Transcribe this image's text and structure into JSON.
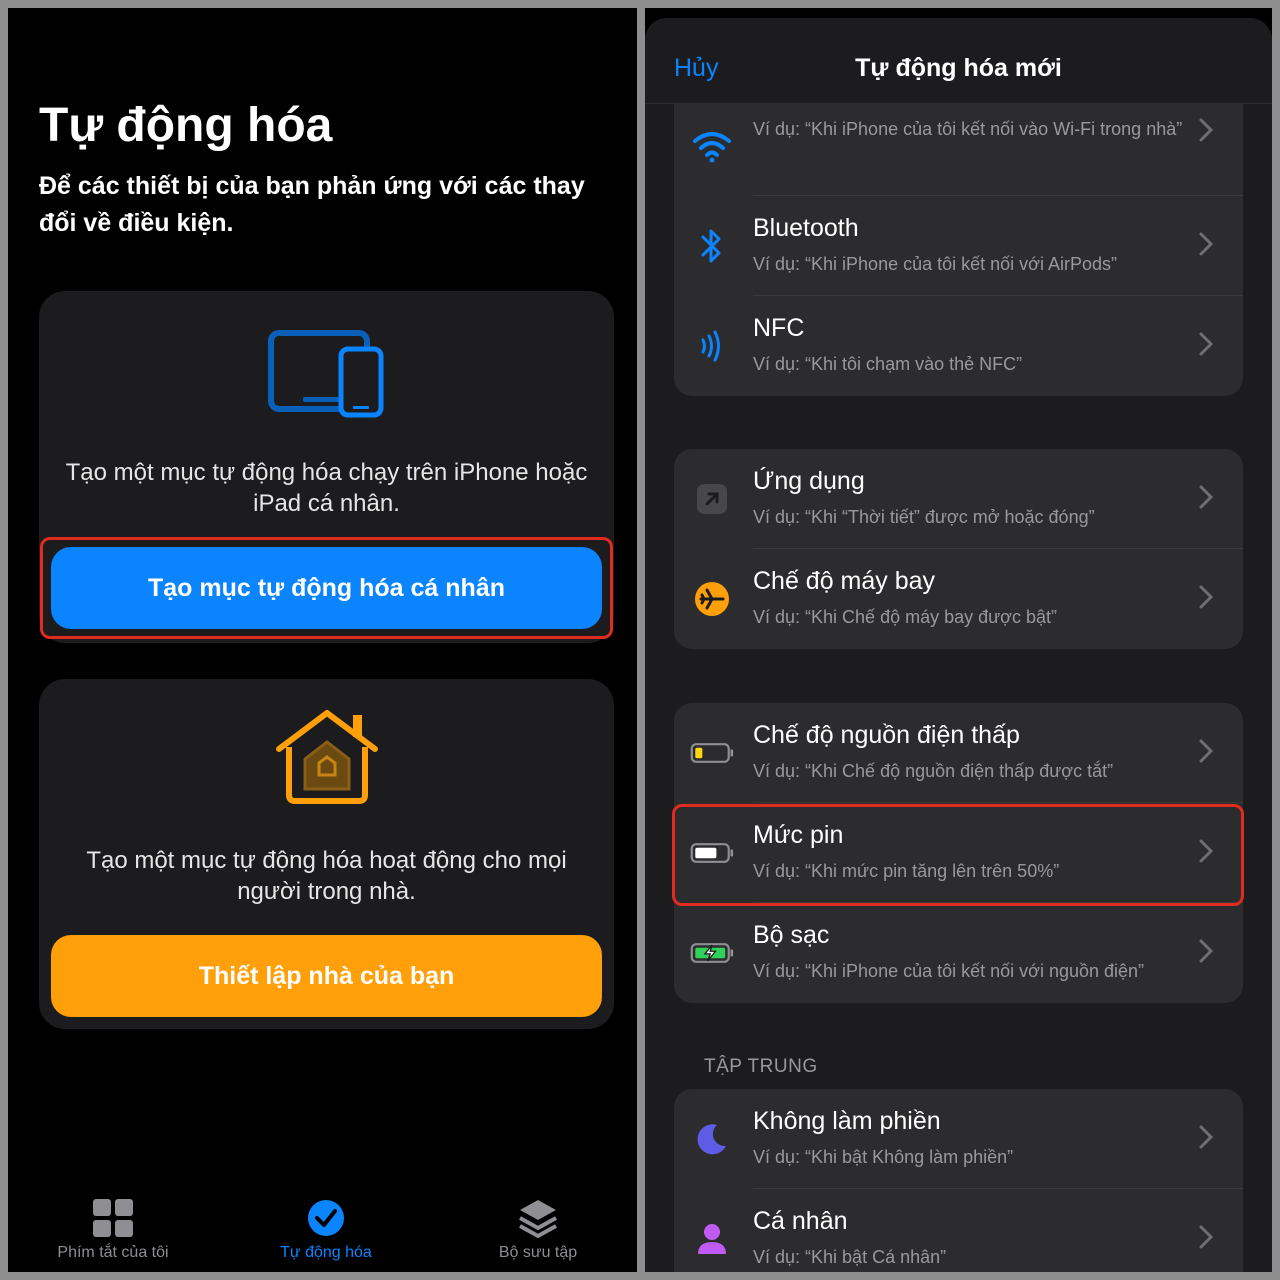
{
  "left": {
    "title": "Tự động hóa",
    "subtitle": "Để các thiết bị của bạn phản ứng với các thay đổi về điều kiện.",
    "personal_card": {
      "icon": "devices-icon",
      "text": "Tạo một mục tự động hóa chạy trên iPhone hoặc iPad cá nhân.",
      "button": "Tạo mục tự động hóa cá nhân",
      "button_color": "#0a84ff"
    },
    "home_card": {
      "icon": "home-icon",
      "text": "Tạo một mục tự động hóa hoạt động cho mọi người trong nhà.",
      "button": "Thiết lập nhà của bạn",
      "button_color": "#ff9f0a"
    },
    "tabs": [
      {
        "label": "Phím tắt của tôi",
        "icon": "grid-icon",
        "active": false
      },
      {
        "label": "Tự động hóa",
        "icon": "automation-check-icon",
        "active": true
      },
      {
        "label": "Bộ sưu tập",
        "icon": "layers-icon",
        "active": false
      }
    ]
  },
  "right": {
    "nav": {
      "cancel": "Hủy",
      "title": "Tự động hóa mới"
    },
    "groups": [
      {
        "rows": [
          {
            "icon": "wifi-icon",
            "title": "",
            "subtitle": "Ví dụ: “Khi iPhone của tôi kết nối vào Wi-Fi trong nhà”"
          },
          {
            "icon": "bluetooth-icon",
            "title": "Bluetooth",
            "subtitle": "Ví dụ: “Khi iPhone của tôi kết nối với AirPods”"
          },
          {
            "icon": "nfc-icon",
            "title": "NFC",
            "subtitle": "Ví dụ: “Khi tôi chạm vào thẻ NFC”"
          }
        ]
      },
      {
        "rows": [
          {
            "icon": "app-icon",
            "title": "Ứng dụng",
            "subtitle": "Ví dụ: “Khi “Thời tiết” được mở hoặc đóng”"
          },
          {
            "icon": "airplane-icon",
            "title": "Chế độ máy bay",
            "subtitle": "Ví dụ: “Khi Chế độ máy bay được bật”"
          }
        ]
      },
      {
        "rows": [
          {
            "icon": "low-power-battery-icon",
            "title": "Chế độ nguồn điện thấp",
            "subtitle": "Ví dụ: “Khi Chế độ nguồn điện thấp được tắt”"
          },
          {
            "icon": "battery-level-icon",
            "title": "Mức pin",
            "subtitle": "Ví dụ: “Khi mức pin tăng lên trên 50%”"
          },
          {
            "icon": "charger-icon",
            "title": "Bộ sạc",
            "subtitle": "Ví dụ: “Khi iPhone của tôi kết nối với nguồn điện”"
          }
        ]
      },
      {
        "label": "TẬP TRUNG",
        "rows": [
          {
            "icon": "moon-icon",
            "title": "Không làm phiền",
            "subtitle": "Ví dụ: “Khi bật Không làm phiền”"
          },
          {
            "icon": "person-icon",
            "title": "Cá nhân",
            "subtitle": "Ví dụ: “Khi bật Cá nhân”"
          }
        ]
      }
    ]
  }
}
